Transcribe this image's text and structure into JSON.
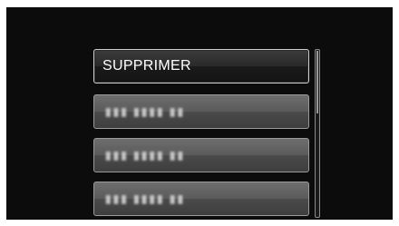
{
  "menu": {
    "items": [
      {
        "label": "SUPPRIMER",
        "selected": true
      },
      {
        "label": "▮▮▮ ▮▮▮▮ ▮▮",
        "blurred": true
      },
      {
        "label": "▮▮▮ ▮▮▮▮ ▮▮",
        "blurred": true
      },
      {
        "label": "▮▮▮ ▮▮▮▮ ▮▮",
        "blurred": true
      }
    ]
  },
  "scrollbar": {
    "position_fraction": 0.0,
    "visible_fraction": 0.38
  },
  "colors": {
    "screen_background": "#0c0c0c",
    "item_background": "#5a5a5a",
    "selected_background": "#1f1f1f",
    "text": "#ffffff"
  }
}
